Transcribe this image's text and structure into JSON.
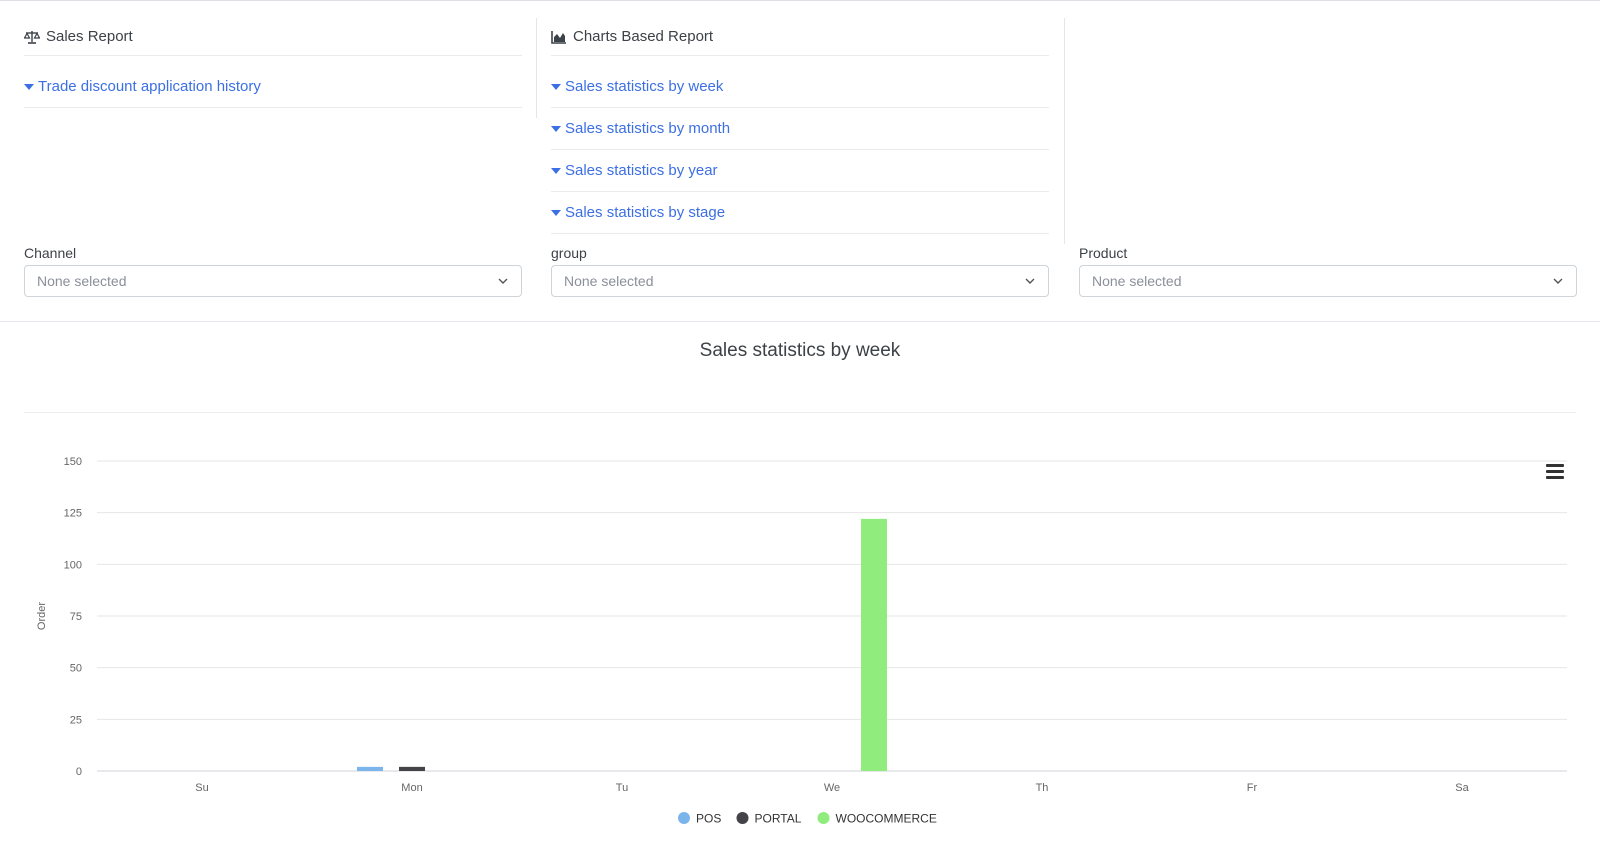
{
  "sales_report": {
    "title": "Sales Report",
    "icon": "scale-icon",
    "links": [
      "Trade discount application history"
    ]
  },
  "charts_report": {
    "title": "Charts Based Report",
    "icon": "area-chart-icon",
    "links": [
      "Sales statistics by week",
      "Sales statistics by month",
      "Sales statistics by year",
      "Sales statistics by stage"
    ]
  },
  "filters": {
    "channel": {
      "label": "Channel",
      "value": "None selected"
    },
    "group": {
      "label": "group",
      "value": "None selected"
    },
    "product": {
      "label": "Product",
      "value": "None selected"
    }
  },
  "chart_title": "Sales statistics by week",
  "chart_menu_icon": "hamburger-menu-icon",
  "chart_data": {
    "type": "bar",
    "categories": [
      "Su",
      "Mon",
      "Tu",
      "We",
      "Th",
      "Fr",
      "Sa"
    ],
    "series": [
      {
        "name": "POS",
        "color": "#7cb5ec",
        "values": [
          0,
          2,
          0,
          0,
          0,
          0,
          0
        ]
      },
      {
        "name": "PORTAL",
        "color": "#434348",
        "values": [
          0,
          2,
          0,
          0,
          0,
          0,
          0
        ]
      },
      {
        "name": "WOOCOMMERCE",
        "color": "#90ed7d",
        "values": [
          0,
          0,
          0,
          122,
          0,
          0,
          0
        ]
      }
    ],
    "ylabel": "Order",
    "yticks": [
      0,
      25,
      50,
      75,
      100,
      125,
      150
    ],
    "ylim": [
      0,
      150
    ],
    "grid": true,
    "legend": "bottom-center"
  }
}
